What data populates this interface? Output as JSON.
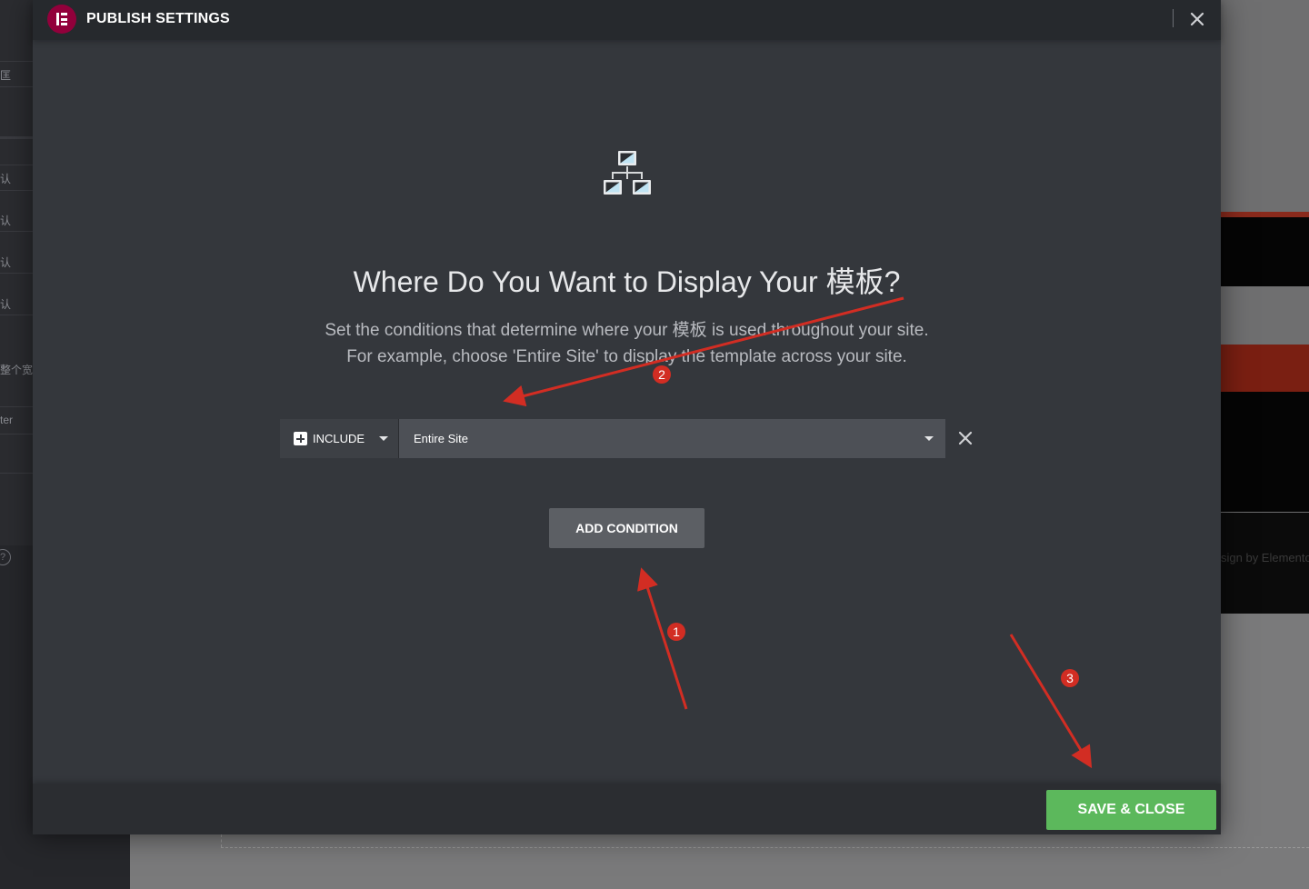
{
  "background": {
    "left_panel_fragments": [
      "匡",
      "认",
      "认",
      "认",
      "认",
      "整个宽度",
      "ter"
    ],
    "right_fragment": "sign by Elementor"
  },
  "modal": {
    "title": "PUBLISH SETTINGS",
    "logo_icon": "elementor-logo-icon",
    "close_icon": "close-icon",
    "illustration_icon": "sitemap-hierarchy-icon",
    "heading": "Where Do You Want to Display Your 模板?",
    "description_line1": "Set the conditions that determine where your 模板 is used throughout your site.",
    "description_line2": "For example, choose 'Entire Site' to display the template across your site.",
    "condition": {
      "type_label": "INCLUDE",
      "type_icon": "plus-square-icon",
      "scope_value": "Entire Site",
      "remove_icon": "close-icon"
    },
    "add_condition_label": "ADD CONDITION",
    "save_close_label": "SAVE & CLOSE"
  },
  "annotations": {
    "marker1": "1",
    "marker2": "2",
    "marker3": "3",
    "color": "#d22d23"
  },
  "colors": {
    "modal_bg": "#34373c",
    "header_bg": "#26292d",
    "logo_bg": "#92003b",
    "save_bg": "#5cb85c",
    "add_bg": "#5c5f64"
  }
}
